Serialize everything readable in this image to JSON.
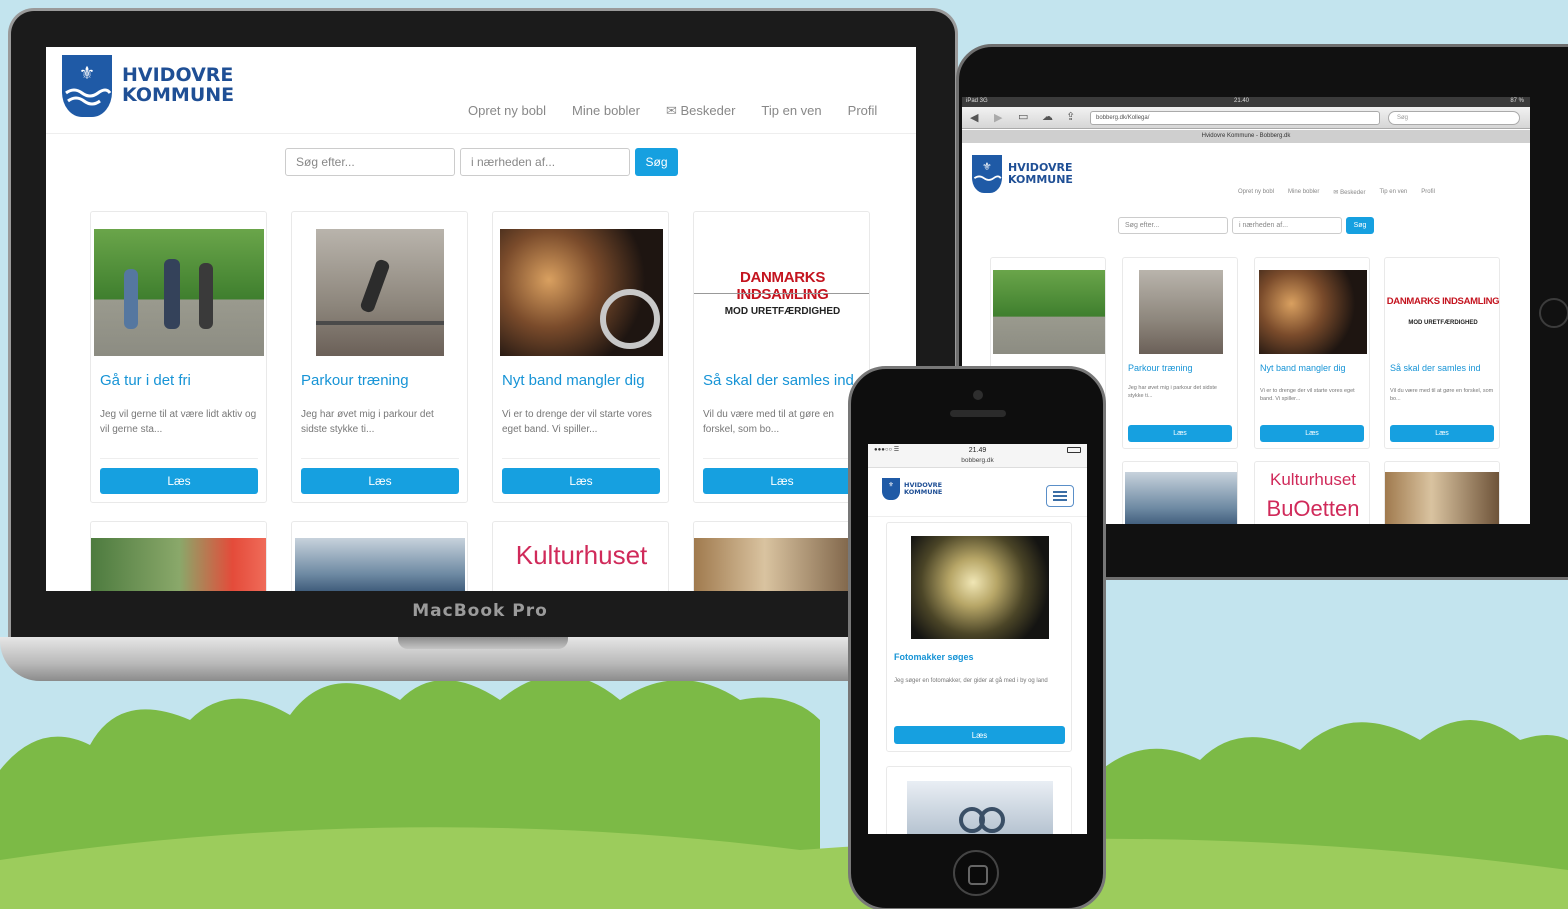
{
  "site": {
    "logo_line1": "HVIDOVRE",
    "logo_line2": "KOMMUNE",
    "nav": [
      "Opret ny bobl",
      "Mine bobler",
      "Beskeder",
      "Tip en ven",
      "Profil"
    ],
    "search_placeholder": "Søg efter...",
    "near_placeholder": "i nærheden af...",
    "search_button": "Søg",
    "read_button": "Læs"
  },
  "laptop": {
    "brand": "MacBook Pro",
    "cards": [
      {
        "title": "Gå tur i det fri",
        "desc": "Jeg vil gerne til at være lidt aktiv og vil gerne sta...",
        "button": "Læs"
      },
      {
        "title": "Parkour træning",
        "desc": "Jeg har øvet mig i parkour det sidste stykke ti...",
        "button": "Læs"
      },
      {
        "title": "Nyt band mangler dig",
        "desc": "Vi er to drenge der vil starte vores eget band. Vi spiller...",
        "button": "Læs"
      },
      {
        "title": "Så skal der samles ind",
        "desc": "Vil du være med til at gøre en forskel, som bo...",
        "button": "Læs"
      }
    ],
    "card4_image_line1": "DANMARKS INDSAMLING",
    "card4_image_line2": "MOD URETFÆRDIGHED",
    "row2_image_text_line1": "Kulturhuset"
  },
  "tablet": {
    "status_time": "21.40",
    "status_left": "iPad 3G",
    "status_right": "87 %",
    "url": "bobberg.dk/Kollega/",
    "search_field": "Søg",
    "tab_title": "Hvidovre Kommune - Bobberg.dk",
    "card_titles": [
      "Parkour træning",
      "Nyt band mangler dig",
      "Så skal der samles ind"
    ],
    "card_descs": [
      "Jeg har øvet mig i parkour det sidste stykke ti...",
      "Vi er to drenge der vil starte vores eget band. Vi spiller...",
      "Vil du være med til at gøre en forskel, som bo..."
    ],
    "row2_image_text_line1": "Kulturhuset",
    "row2_image_text_line2": "BuOetten"
  },
  "phone": {
    "status_time": "21.49",
    "url": "bobberg.dk",
    "card_title": "Fotomakker søges",
    "card_desc": "Jeg søger en fotomakker, der gider at gå med i by og land",
    "button": "Læs"
  },
  "colors": {
    "accent": "#16a0e0",
    "title": "#1794d6",
    "logo": "#1f4f95",
    "sky": "#c3e4ee",
    "bush": "#7cba46",
    "grass": "#9ccc5c"
  }
}
